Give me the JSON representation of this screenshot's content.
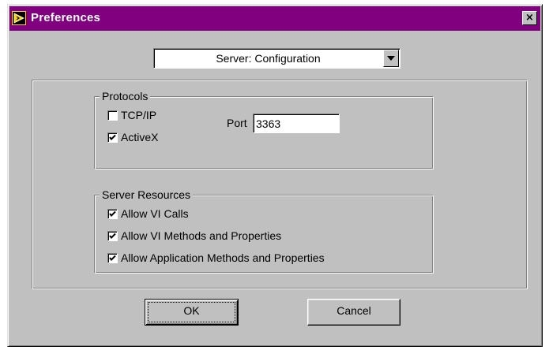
{
  "window": {
    "title": "Preferences",
    "close_label": "×",
    "titlebar_color": "#800080",
    "app_icon": "labview-arrow-icon"
  },
  "category_select": {
    "selected": "Server: Configuration"
  },
  "protocols": {
    "legend": "Protocols",
    "tcpip": {
      "label": "TCP/IP",
      "checked": false
    },
    "activex": {
      "label": "ActiveX",
      "checked": true
    },
    "port_label": "Port",
    "port_value": "3363"
  },
  "server_resources": {
    "legend": "Server Resources",
    "items": [
      {
        "label": "Allow VI Calls",
        "checked": true
      },
      {
        "label": "Allow VI Methods and Properties",
        "checked": true
      },
      {
        "label": "Allow Application Methods and Properties",
        "checked": true
      }
    ]
  },
  "buttons": {
    "ok": "OK",
    "cancel": "Cancel"
  }
}
